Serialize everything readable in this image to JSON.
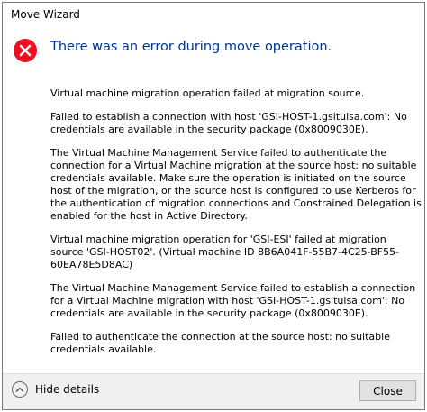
{
  "window": {
    "title": "Move Wizard"
  },
  "dialog": {
    "icon": "error-icon",
    "main_instruction": "There was an error during move operation.",
    "accent_color": "#003399",
    "error_color": "#e81123",
    "details": [
      "Virtual machine migration operation failed at migration source.",
      "Failed to establish a connection with host 'GSI-HOST-1.gsitulsa.com': No credentials are available in the security package (0x8009030E).",
      "The Virtual Machine Management Service failed to authenticate the connection for a Virtual Machine migration at the source host: no suitable credentials available. Make sure the operation is initiated on the source host of the migration, or the source host is configured to use Kerberos for the authentication of migration connections and Constrained Delegation is enabled for the host in Active Directory.",
      "Virtual machine migration operation for 'GSI-ESI' failed at migration source 'GSI-HOST02'. (Virtual machine ID 8B6A041F-55B7-4C25-BF55-60EA78E5D8AC)",
      "The Virtual Machine Management Service failed to establish a connection for a Virtual Machine migration with host 'GSI-HOST-1.gsitulsa.com': No credentials are available in the security package (0x8009030E).",
      "Failed to authenticate the connection at the source host: no suitable credentials available."
    ]
  },
  "footer": {
    "toggle_icon": "chevron-up-icon",
    "hide_details_label": "Hide details",
    "close_label": "Close"
  }
}
